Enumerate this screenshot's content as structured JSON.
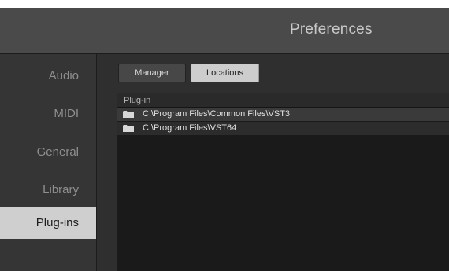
{
  "window": {
    "title": "Preferences"
  },
  "sidebar": {
    "items": [
      {
        "label": "Audio",
        "selected": false
      },
      {
        "label": "MIDI",
        "selected": false
      },
      {
        "label": "General",
        "selected": false
      },
      {
        "label": "Library",
        "selected": false
      },
      {
        "label": "Plug-ins",
        "selected": true
      }
    ]
  },
  "toolbar": {
    "manager_label": "Manager",
    "locations_label": "Locations",
    "active_tab": "Locations"
  },
  "list": {
    "header": "Plug-in",
    "rows": [
      {
        "icon": "folder-icon",
        "path": "C:\\Program Files\\Common Files\\VST3"
      },
      {
        "icon": "folder-icon",
        "path": "C:\\Program Files\\VST64"
      }
    ]
  },
  "colors": {
    "selected_bg": "#cfcfcf",
    "panel_bg": "#2e2e2e",
    "titlebar_bg": "#4a4a4a"
  }
}
